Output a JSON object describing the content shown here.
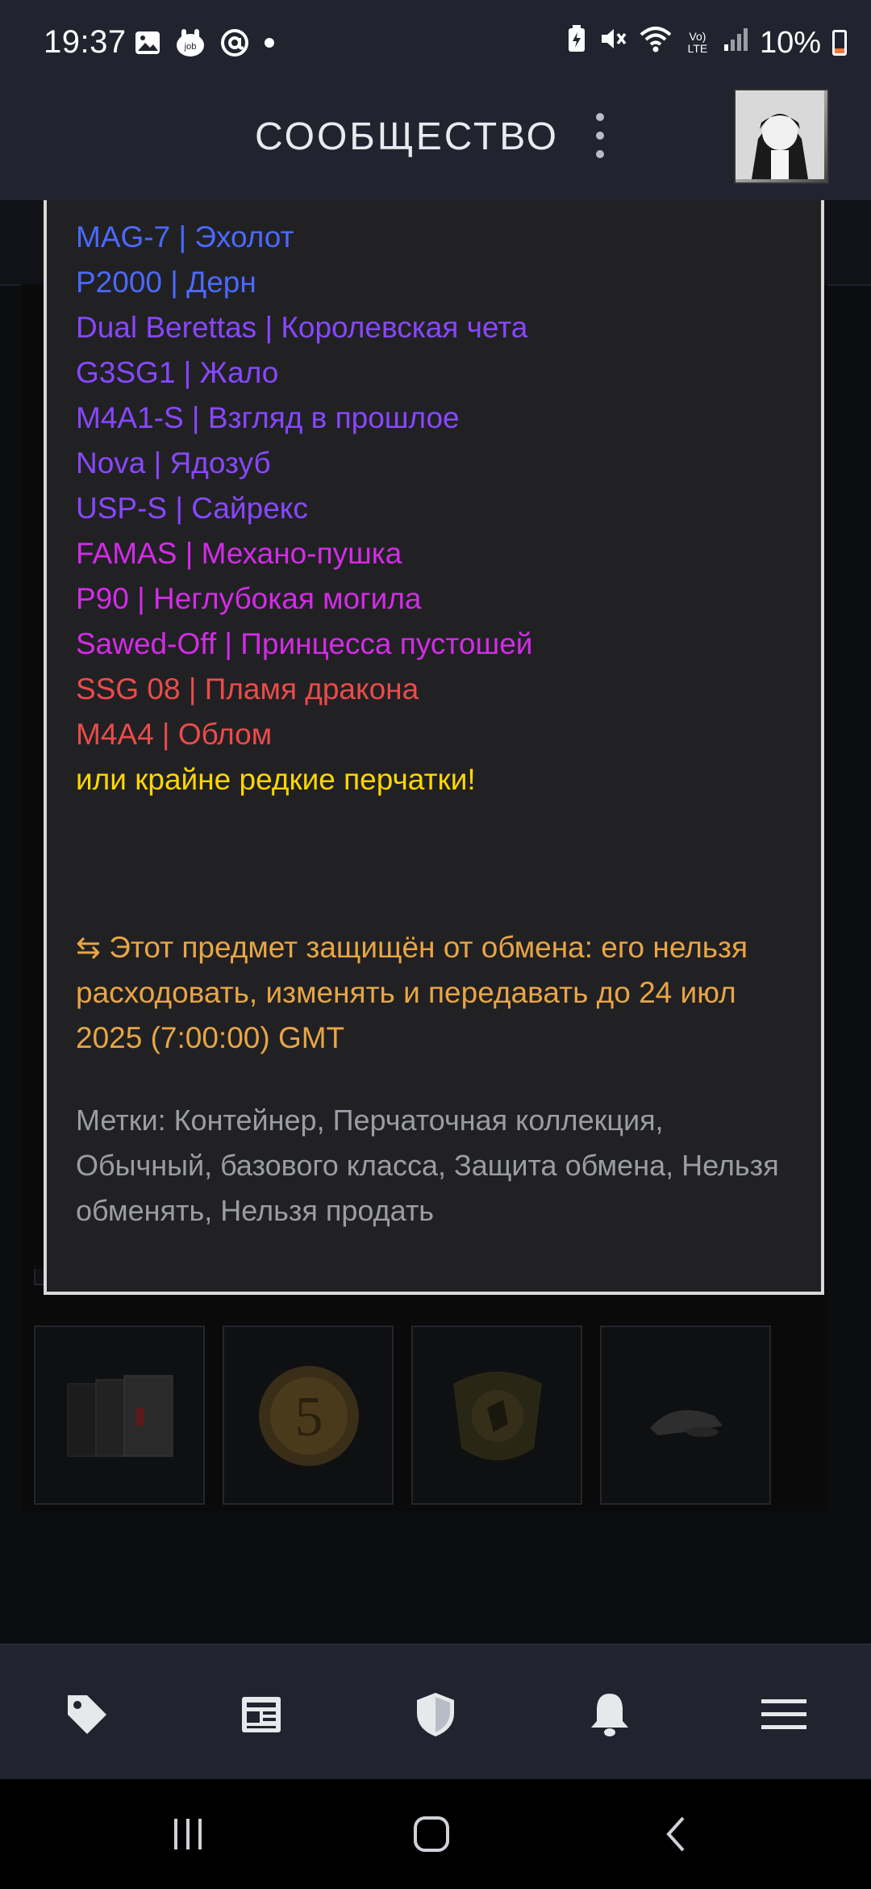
{
  "status_bar": {
    "time": "19:37",
    "battery": "10%",
    "icons": [
      "gallery-icon",
      "job-app-icon",
      "at-icon",
      "dot-icon",
      "battery-saver-icon",
      "mute-icon",
      "wifi-icon",
      "volte-icon",
      "signal-icon",
      "battery-icon"
    ],
    "volte_label": "Vo) LTE"
  },
  "header": {
    "title": "СООБЩЕСТВО"
  },
  "tooltip": {
    "items": [
      {
        "text": "MAG-7 | Эхолот",
        "color": "#4b69ff"
      },
      {
        "text": "P2000 | Дерн",
        "color": "#4b69ff"
      },
      {
        "text": "Dual Berettas | Королевская чета",
        "color": "#8847ff"
      },
      {
        "text": "G3SG1 | Жало",
        "color": "#8847ff"
      },
      {
        "text": "M4A1-S | Взгляд в прошлое",
        "color": "#8847ff"
      },
      {
        "text": "Nova | Ядозуб",
        "color": "#8847ff"
      },
      {
        "text": "USP-S | Сайрекс",
        "color": "#8847ff"
      },
      {
        "text": "FAMAS | Механо-пушка",
        "color": "#d32ce6"
      },
      {
        "text": "P90 | Неглубокая могила",
        "color": "#d32ce6"
      },
      {
        "text": "Sawed-Off | Принцесса пустошей",
        "color": "#d32ce6"
      },
      {
        "text": "SSG 08 | Пламя дракона",
        "color": "#eb4b4b"
      },
      {
        "text": "M4A4 | Облом",
        "color": "#eb4b4b"
      }
    ],
    "gloves_text": "или крайне редкие перчатки!",
    "gloves_color": "#ffd700",
    "trade_notice": "⇆ Этот предмет защищён от обмена: его нельзя расходовать, изменять и передавать до 24 июл 2025 (7:00:00) GMT",
    "trade_notice_color": "#e8a545",
    "tags": "Метки: Контейнер, Перчаточная коллекция, Обычный, базового класса, Защита обмена, Нельзя обменять, Нельзя продать",
    "tags_color": "#9a9da3"
  },
  "inventory": {
    "bottom_row": [
      {
        "icon": "case-stack-icon"
      },
      {
        "icon": "coin-5-icon"
      },
      {
        "icon": "csgo-badge-icon"
      },
      {
        "icon": "cap-icon"
      }
    ]
  },
  "bottom_nav": {
    "items": [
      "tag-icon",
      "news-icon",
      "shield-icon",
      "bell-icon",
      "menu-icon"
    ]
  },
  "android_nav": {
    "items": [
      "recents-button",
      "home-button",
      "back-button"
    ]
  }
}
